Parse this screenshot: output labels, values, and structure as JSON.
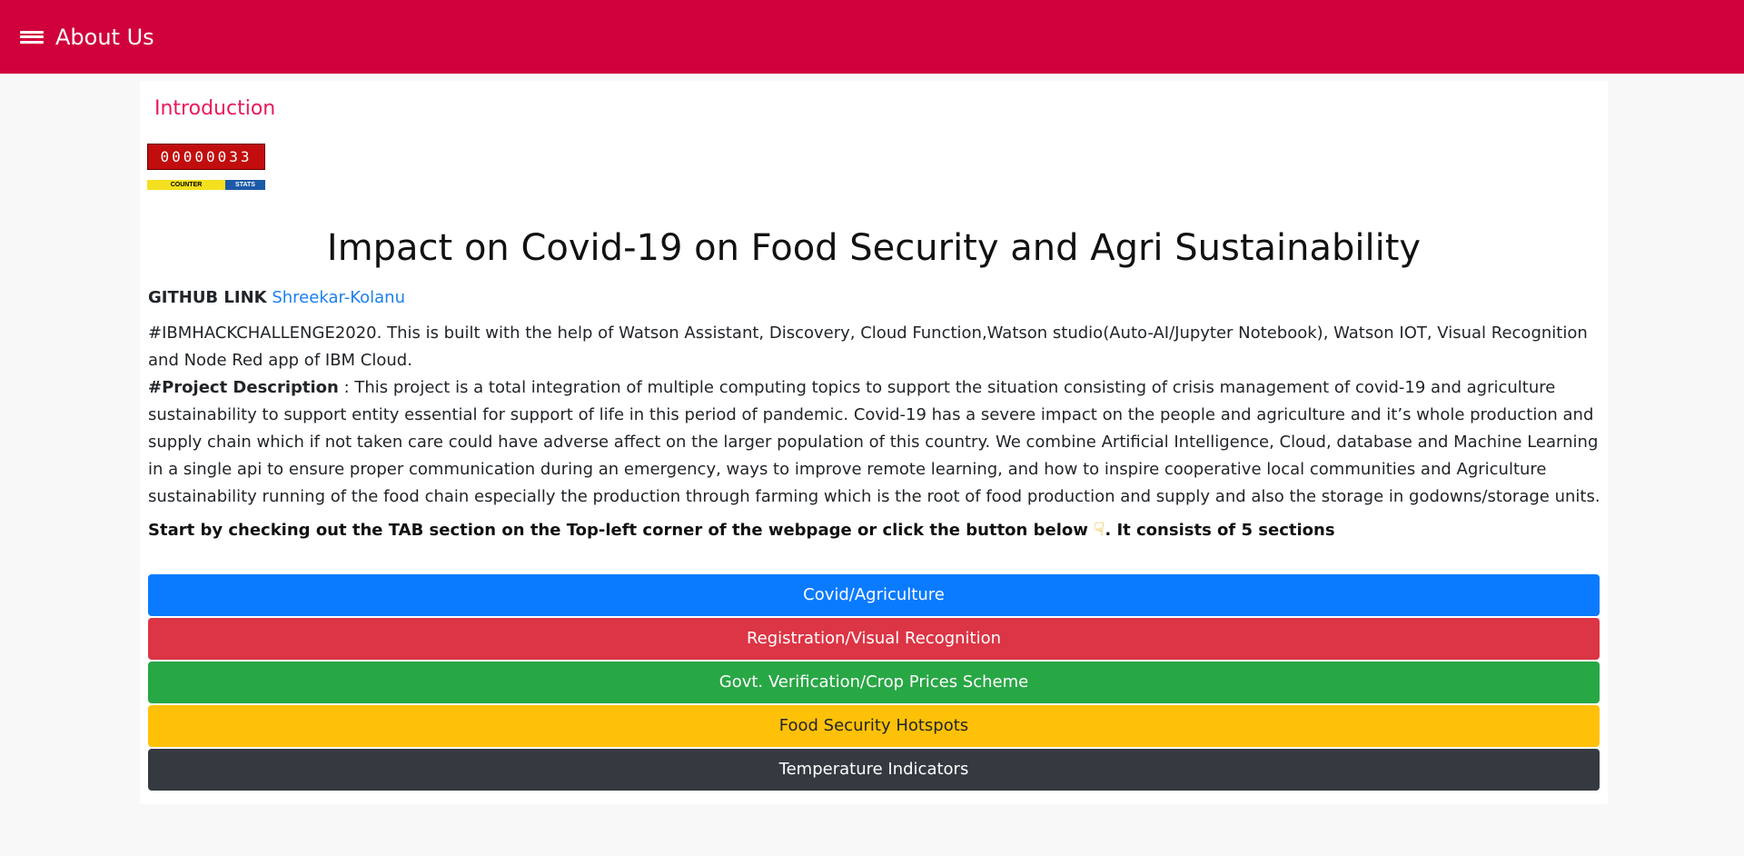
{
  "header": {
    "menu_icon": "hamburger-menu-icon",
    "title": "About Us",
    "color": "#d0003c"
  },
  "intro": {
    "heading": "Introduction",
    "counter": {
      "digits": "00000033",
      "label_left": "COUNTER",
      "label_right": "STATS"
    }
  },
  "main": {
    "title": "Impact on Covid-19 on Food Security and Agri Sustainability",
    "github_label": "GITHUB LINK",
    "github_link_text": "Shreekar-Kolanu",
    "hackathon_text": "#IBMHACKCHALLENGE2020. This is built with the help of Watson Assistant, Discovery, Cloud Function,Watson studio(Auto-AI/Jupyter Notebook), Watson IOT, Visual Recognition and Node Red app of IBM Cloud.",
    "project_label": "#Project Description",
    "project_text": " : This project is a total integration of multiple computing topics to support the situation consisting of crisis management of covid-19 and agriculture sustainability to support entity essential for support of life in this period of pandemic. Covid-19 has a severe impact on the people and agriculture and it’s whole production and supply chain which if not taken care could have adverse affect on the larger population of this country. We combine Artificial Intelligence, Cloud, database and Machine Learning in a single api to ensure proper communication during an emergency, ways to improve remote learning, and how to inspire cooperative local communities and Agriculture sustainability running of the food chain especially the production through farming which is the root of food production and supply and also the storage in godowns/storage units.",
    "start_text_before": "Start by checking out the TAB section on the Top-left corner of the webpage or click the button below ",
    "start_icon": "pointing-down-hand-icon",
    "start_text_after": ". It consists of 5 sections"
  },
  "sections": [
    {
      "label": "Covid/Agriculture",
      "color": "#0a7bff"
    },
    {
      "label": "Registration/Visual Recognition",
      "color": "#dc3545"
    },
    {
      "label": "Govt. Verification/Crop Prices Scheme",
      "color": "#28a745"
    },
    {
      "label": "Food Security Hotspots",
      "color": "#ffc107"
    },
    {
      "label": "Temperature Indicators",
      "color": "#343a40"
    }
  ]
}
